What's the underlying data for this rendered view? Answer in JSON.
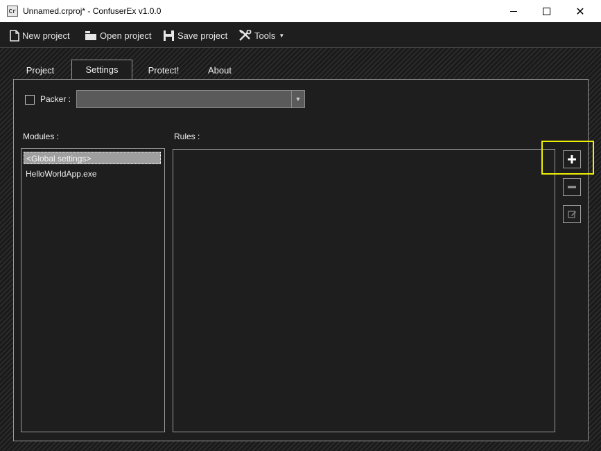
{
  "window": {
    "title": "Unnamed.crproj* - ConfuserEx v1.0.0",
    "icon_text": "Cr",
    "controls": [
      "minimize-icon",
      "maximize-icon",
      "close-icon"
    ]
  },
  "toolbar": {
    "new_label": "New project",
    "open_label": "Open project",
    "save_label": "Save project",
    "tools_label": "Tools"
  },
  "tabs": [
    {
      "label": "Project",
      "active": false
    },
    {
      "label": "Settings",
      "active": true
    },
    {
      "label": "Protect!",
      "active": false
    },
    {
      "label": "About",
      "active": false
    }
  ],
  "settings": {
    "packer_label": "Packer :",
    "packer_checked": false,
    "packer_value": "",
    "modules_label": "Modules :",
    "rules_label": "Rules :",
    "modules": [
      "<Global settings>",
      "HelloWorldApp.exe"
    ],
    "selected_module": "<Global settings>",
    "rules": []
  },
  "colors": {
    "background": "#1e1e1e",
    "border": "#9a9a9a",
    "selection": "#9e9e9e",
    "highlight": "#f0f000"
  }
}
